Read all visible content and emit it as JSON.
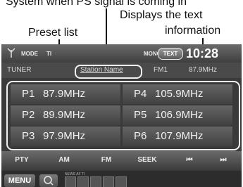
{
  "annotations": {
    "top_partial": "System when PS signal is coming in",
    "text_info_line1": "Displays the text",
    "text_info_line2": "information",
    "preset_list": "Preset list"
  },
  "status_bar": {
    "mode_label": "MODE",
    "ti_label": "TI",
    "mono_label": "MONO",
    "text_button": "TEXT",
    "clock": "10:28"
  },
  "info_bar": {
    "source": "TUNER",
    "station_name": "Station Name",
    "band": "FM1",
    "frequency": "87.9MHz"
  },
  "presets": [
    {
      "label": "P1",
      "freq": "87.9MHz"
    },
    {
      "label": "P2",
      "freq": "89.9MHz"
    },
    {
      "label": "P3",
      "freq": "97.9MHz"
    },
    {
      "label": "P4",
      "freq": "105.9MHz"
    },
    {
      "label": "P5",
      "freq": "106.9MHz"
    },
    {
      "label": "P6",
      "freq": "107.9MHz"
    }
  ],
  "controls": {
    "pty": "PTY",
    "am": "AM",
    "fm": "FM",
    "seek": "SEEK",
    "prev": "⏮",
    "next": "⏭"
  },
  "bottom_bar": {
    "menu": "MENU",
    "indicators": "NEWS AF TI"
  },
  "icons": {
    "antenna": "antenna-icon",
    "search": "search-icon",
    "previous": "skip-previous-icon",
    "next": "skip-next-icon"
  }
}
